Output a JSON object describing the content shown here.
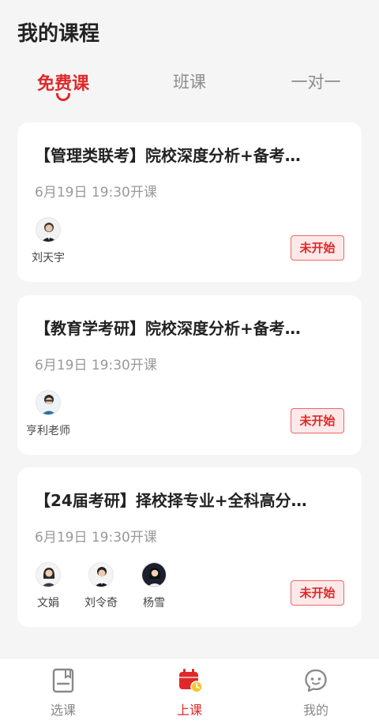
{
  "header": {
    "title": "我的课程"
  },
  "tabs": [
    {
      "label": "免费课",
      "active": true
    },
    {
      "label": "班课",
      "active": false
    },
    {
      "label": "一对一",
      "active": false
    }
  ],
  "courses": [
    {
      "title": "【管理类联考】院校深度分析+备考…",
      "time": "6月19日 19:30开课",
      "teachers": [
        {
          "name": "刘天宇"
        }
      ],
      "status": "未开始"
    },
    {
      "title": "【教育学考研】院校深度分析+备考…",
      "time": "6月19日 19:30开课",
      "teachers": [
        {
          "name": "亨利老师"
        }
      ],
      "status": "未开始"
    },
    {
      "title": "【24届考研】择校择专业+全科高分…",
      "time": "6月19日 19:30开课",
      "teachers": [
        {
          "name": "文娟"
        },
        {
          "name": "刘令奇"
        },
        {
          "name": "杨雪"
        }
      ],
      "status": "未开始"
    }
  ],
  "bottom_nav": [
    {
      "label": "选课",
      "icon": "book-icon",
      "active": false
    },
    {
      "label": "上课",
      "icon": "calendar-clock-icon",
      "active": true
    },
    {
      "label": "我的",
      "icon": "chat-face-icon",
      "active": false
    }
  ],
  "colors": {
    "accent": "#e02828",
    "background": "#f5f5f5",
    "card": "#ffffff",
    "muted": "#999999"
  }
}
